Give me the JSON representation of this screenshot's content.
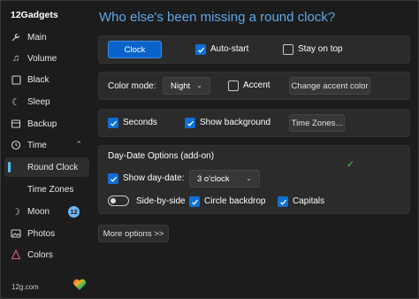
{
  "app": {
    "title": "12Gadgets"
  },
  "sidebar": {
    "items": [
      {
        "label": "Main",
        "icon": "wrench-icon"
      },
      {
        "label": "Volume",
        "icon": "music-note-icon"
      },
      {
        "label": "Black",
        "icon": "square-icon"
      },
      {
        "label": "Sleep",
        "icon": "moon-icon"
      },
      {
        "label": "Backup",
        "icon": "backup-icon"
      },
      {
        "label": "Time",
        "icon": "clock-icon"
      },
      {
        "label": "Round Clock",
        "icon": ""
      },
      {
        "label": "Time Zones",
        "icon": ""
      },
      {
        "label": "Moon",
        "icon": "moon-star-icon"
      },
      {
        "label": "Photos",
        "icon": "photo-icon"
      },
      {
        "label": "Colors",
        "icon": "palette-icon"
      }
    ],
    "moon_badge": "12",
    "footer_link": "12g.com"
  },
  "main": {
    "title": "Who else's been missing a round clock?",
    "card1": {
      "clock_button": "Clock",
      "autostart_label": "Auto-start",
      "autostart_checked": true,
      "stay_on_top_label": "Stay on top",
      "stay_on_top_checked": false
    },
    "card2": {
      "color_mode_label": "Color mode:",
      "color_mode_value": "Night",
      "accent_label": "Accent",
      "accent_checked": false,
      "change_accent_button": "Change accent color"
    },
    "card3": {
      "seconds_label": "Seconds",
      "seconds_checked": true,
      "show_background_label": "Show background",
      "show_background_checked": true,
      "time_zones_button": "Time Zones..."
    },
    "card4": {
      "title": "Day-Date Options (add-on)",
      "show_day_date_label": "Show day-date:",
      "show_day_date_checked": true,
      "position_value": "3 o'clock",
      "side_by_side_label": "Side-by-side",
      "side_by_side_on": false,
      "circle_backdrop_label": "Circle backdrop",
      "circle_backdrop_checked": true,
      "capitals_label": "Capitals",
      "capitals_checked": true
    },
    "more_options_button": "More options >>"
  },
  "colors": {
    "accent": "#0f6fd6",
    "title_blue": "#5fa7e8",
    "badge": "#6cb8f6",
    "check_green": "#5ec15e"
  }
}
